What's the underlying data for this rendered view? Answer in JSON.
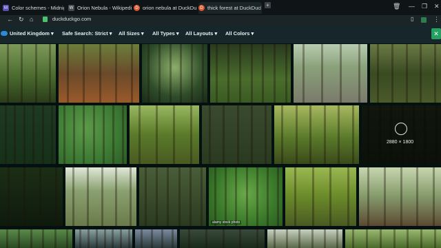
{
  "tabs": [
    {
      "label": "Color schemes - Midnight Lizard",
      "favicon": "M",
      "color": "#5a4fb5",
      "active": false
    },
    {
      "label": "Orion Nebula - Wikipedia",
      "favicon": "W",
      "color": "#444b4e",
      "active": false
    },
    {
      "label": "orion nebula at DuckDuckGo",
      "favicon": "D",
      "color": "#de5833",
      "active": false
    },
    {
      "label": "thick forest at DuckDuckGo",
      "favicon": "D",
      "color": "#de5833",
      "active": true
    }
  ],
  "new_tab_symbol": "+",
  "window_controls": {
    "minimize": "—",
    "maximize": "❐",
    "close": "✕"
  },
  "nav": {
    "back": "←",
    "forward": "›",
    "reload": "↻",
    "home": "⌂",
    "url": "duckduckgo.com"
  },
  "filters": {
    "region": "United Kingdom ▾",
    "safe_search": "Safe Search: Strict ▾",
    "size": "All Sizes ▾",
    "types": "All Types ▾",
    "layouts": "All Layouts ▾",
    "colors": "All Colors ▾",
    "close": "✕"
  },
  "images": {
    "hover_dimensions": "2880 × 1800",
    "watermark": "alamy stock photo"
  }
}
